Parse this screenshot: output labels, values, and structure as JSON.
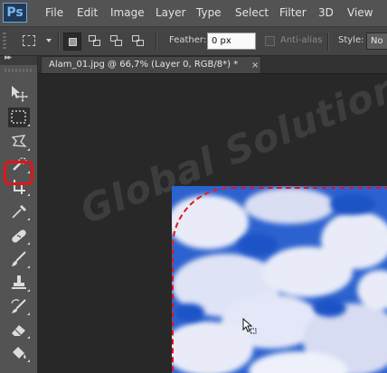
{
  "app": {
    "logo": "Ps"
  },
  "menu": [
    "File",
    "Edit",
    "Image",
    "Layer",
    "Type",
    "Select",
    "Filter",
    "3D",
    "View"
  ],
  "options": {
    "feather_label": "Feather:",
    "feather_value": "0 px",
    "antialias_label": "Anti-alias",
    "antialias_checked": false,
    "style_label": "Style:",
    "style_value": "No"
  },
  "document_tab": {
    "title": "Alam_01.jpg @ 66,7% (Layer 0, RGB/8*) *",
    "close": "×"
  },
  "toolbar": {
    "header": "▸▸",
    "tools": [
      {
        "name": "move-tool",
        "icon": "move-icon"
      },
      {
        "name": "rectangular-marquee-tool",
        "icon": "marquee-icon",
        "selected": true
      },
      {
        "name": "lasso-tool",
        "icon": "lasso-icon"
      },
      {
        "name": "quick-selection-tool",
        "icon": "quick-selection-icon"
      },
      {
        "name": "crop-tool",
        "icon": "crop-icon"
      },
      {
        "name": "eyedropper-tool",
        "icon": "eyedropper-icon"
      },
      {
        "name": "healing-brush-tool",
        "icon": "bandage-icon"
      },
      {
        "name": "brush-tool",
        "icon": "brush-icon"
      },
      {
        "name": "clone-stamp-tool",
        "icon": "stamp-icon"
      },
      {
        "name": "history-brush-tool",
        "icon": "history-brush-icon"
      },
      {
        "name": "eraser-tool",
        "icon": "eraser-icon"
      },
      {
        "name": "paint-bucket-tool",
        "icon": "bucket-icon"
      }
    ]
  },
  "watermark": "Global Solutions",
  "colors": {
    "highlight": "#e0141a",
    "selection_red": "#e0141a",
    "sky": "#2f66d0"
  }
}
